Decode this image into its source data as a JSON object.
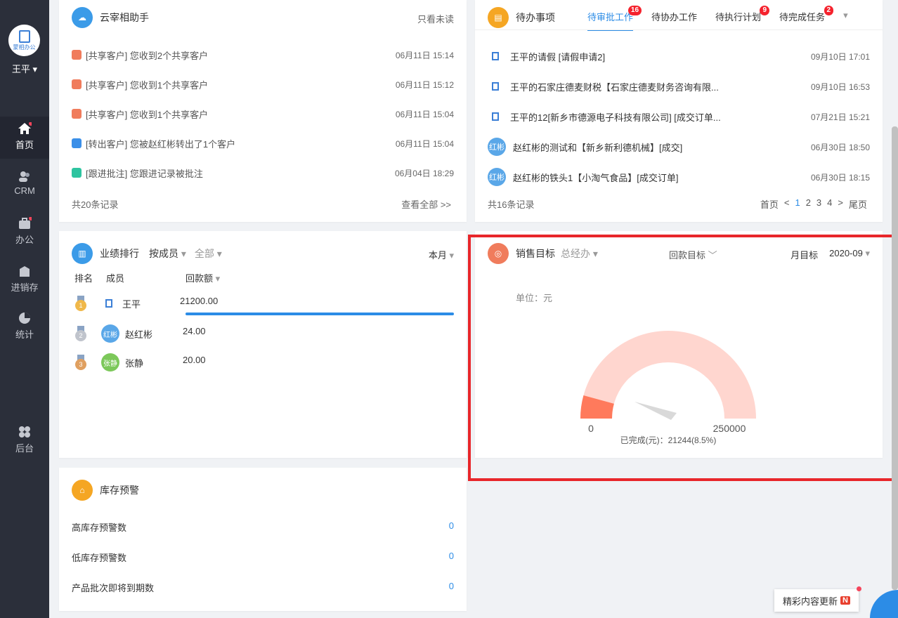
{
  "sidebar": {
    "user": "王平",
    "logo_text": "蒙相办公",
    "nav": [
      {
        "label": "首页"
      },
      {
        "label": "CRM"
      },
      {
        "label": "办公"
      },
      {
        "label": "进销存"
      },
      {
        "label": "统计"
      },
      {
        "label": "后台"
      }
    ]
  },
  "assistant": {
    "title": "云宰相助手",
    "filter": "只看未读",
    "icon_text": "云宰相",
    "items": [
      {
        "text": "[共享客户] 您收到2个共享客户",
        "time": "06月11日 15:14",
        "color": "#f07c5c"
      },
      {
        "text": "[共享客户] 您收到1个共享客户",
        "time": "06月11日 15:12",
        "color": "#f07c5c"
      },
      {
        "text": "[共享客户] 您收到1个共享客户",
        "time": "06月11日 15:04",
        "color": "#f07c5c"
      },
      {
        "text": "[转出客户] 您被赵红彬转出了1个客户",
        "time": "06月11日 15:04",
        "color": "#3b8fe8"
      },
      {
        "text": "[跟进批注] 您跟进记录被批注",
        "time": "06月04日 18:29",
        "color": "#2ec4a0"
      }
    ],
    "total": "共20条记录",
    "view_all": "查看全部 >>"
  },
  "todo": {
    "title": "待办事项",
    "tabs": [
      {
        "label": "待审批工作",
        "badge": "16"
      },
      {
        "label": "待协办工作",
        "badge": ""
      },
      {
        "label": "待执行计划",
        "badge": "9"
      },
      {
        "label": "待完成任务",
        "badge": "2"
      }
    ],
    "more": "▾",
    "items": [
      {
        "avatar": "",
        "text": "王平的请假 [请假申请2]",
        "time": "09月10日 17:01"
      },
      {
        "avatar": "",
        "text": "王平的石家庄德麦财税【石家庄德麦财务咨询有限...",
        "time": "09月10日 16:53"
      },
      {
        "avatar": "",
        "text": "王平的12[新乡市德源电子科技有限公司] [成交订单...",
        "time": "07月21日 15:21"
      },
      {
        "avatar": "红彬",
        "text": "赵红彬的测试和【新乡新利德机械】[成交]",
        "time": "06月30日 18:50"
      },
      {
        "avatar": "红彬",
        "text": "赵红彬的铁头1【小淘气食品】[成交订单]",
        "time": "06月30日 18:15"
      }
    ],
    "total": "共16条记录",
    "pager": {
      "first": "首页",
      "prev": "<",
      "pages": [
        "1",
        "2",
        "3",
        "4"
      ],
      "next": ">",
      "last": "尾页"
    }
  },
  "ranking": {
    "title": "业绩排行",
    "by": "按成员",
    "scope": "全部",
    "period": "本月",
    "col_rank": "排名",
    "col_member": "成员",
    "col_amount": "回款额",
    "rows": [
      {
        "rank": "1",
        "name": "王平",
        "amount": "21200.00",
        "avatar": "",
        "avatar_color": "#fff",
        "medal": "#f0b84a",
        "bar": 1.0
      },
      {
        "rank": "2",
        "name": "赵红彬",
        "amount": "24.00",
        "avatar": "红彬",
        "avatar_color": "#5aa7e8",
        "medal": "#c0c4cc",
        "bar": 0
      },
      {
        "rank": "3",
        "name": "张静",
        "amount": "20.00",
        "avatar": "张静",
        "avatar_color": "#7cc85a",
        "medal": "#e0a060",
        "bar": 0
      }
    ]
  },
  "target": {
    "title": "销售目标",
    "scope": "总经办",
    "type": "回款目标",
    "period_label": "月目标",
    "period": "2020-09",
    "unit": "单位：元",
    "min": "0",
    "max": "250000",
    "completed": "已完成(元)：21244(8.5%)",
    "ratio": 0.085
  },
  "stock": {
    "title": "库存预警",
    "rows": [
      {
        "label": "高库存预警数",
        "value": "0"
      },
      {
        "label": "低库存预警数",
        "value": "0"
      },
      {
        "label": "产品批次即将到期数",
        "value": "0"
      }
    ]
  },
  "promo": {
    "text": "精彩内容更新",
    "badge": "N"
  }
}
